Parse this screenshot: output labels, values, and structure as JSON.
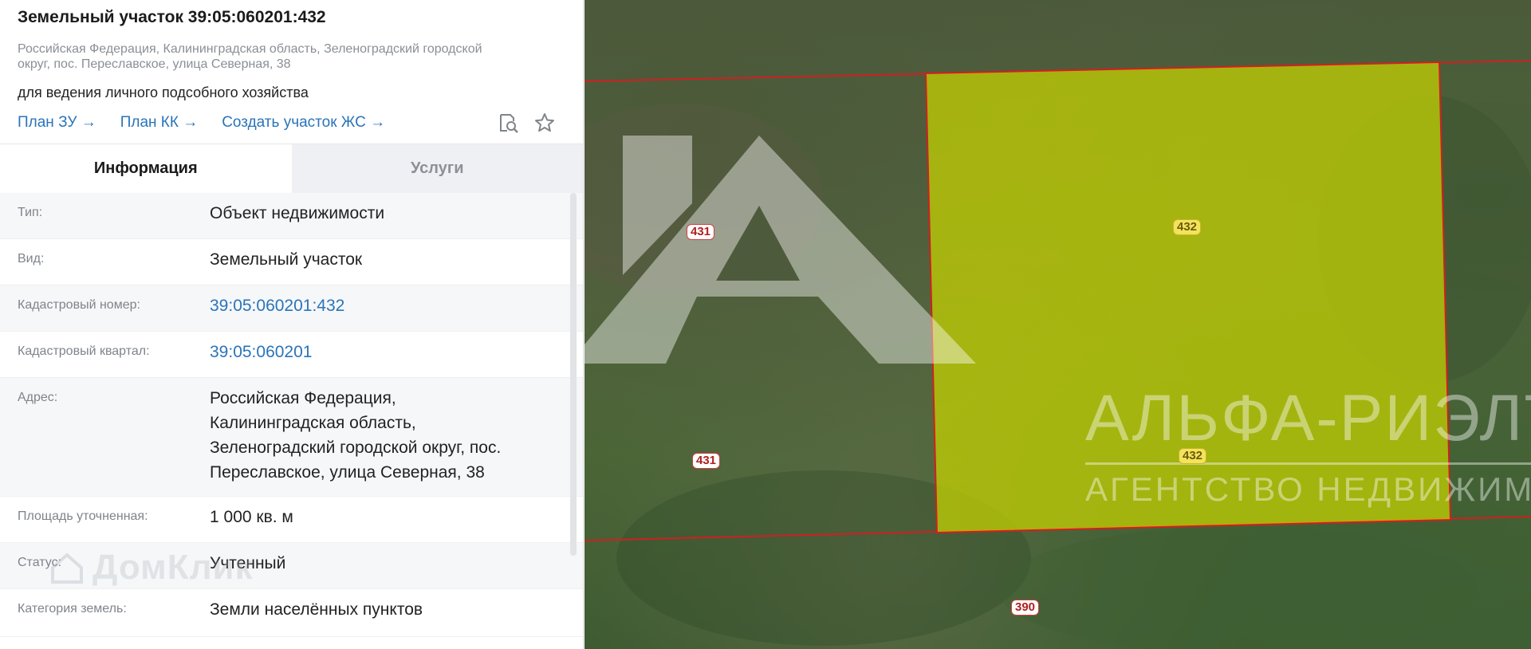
{
  "header": {
    "title": "Земельный участок 39:05:060201:432",
    "address_line1": "Российская Федерация, Калининградская область, Зеленоградский городской",
    "address_line2": "округ, пос. Переславское, улица Северная, 38",
    "purpose": "для ведения личного подсобного хозяйства",
    "links": [
      "План ЗУ →",
      "План КК →",
      "Создать участок ЖС →"
    ],
    "icons": [
      "search-document-icon",
      "star-icon"
    ]
  },
  "tabs": [
    {
      "label": "Информация",
      "active": true
    },
    {
      "label": "Услуги",
      "active": false
    }
  ],
  "info": [
    {
      "label": "Тип:",
      "value": "Объект недвижимости"
    },
    {
      "label": "Вид:",
      "value": "Земельный участок"
    },
    {
      "label": "Кадастровый номер:",
      "value": "39:05:060201:432"
    },
    {
      "label": "Кадастровый квартал:",
      "value": "39:05:060201"
    },
    {
      "label": "Адрес:",
      "value_lines": [
        "Российская Федерация,",
        "Калининградская область,",
        "Зеленоградский городской округ, пос.",
        "Переславское, улица Северная, 38"
      ]
    },
    {
      "label": "Площадь уточненная:",
      "value": "1 000 кв. м"
    },
    {
      "label": "Статус:",
      "value": "Учтенный"
    },
    {
      "label": "Категория земель:",
      "value": "Земли населённых пунктов"
    }
  ],
  "watermarks": {
    "domclick": "ДомКлик",
    "agency_name": "АЛЬФА-РИЭЛТ",
    "agency_sub": "АГЕНТСТВО НЕДВИЖИМОСТИ"
  },
  "map": {
    "parcel_labels": [
      "431",
      "432",
      "431",
      "432",
      "390"
    ],
    "colors": {
      "selected_fill": "#c8d400",
      "boundary": "#d02020",
      "link": "#2a74b8"
    }
  }
}
